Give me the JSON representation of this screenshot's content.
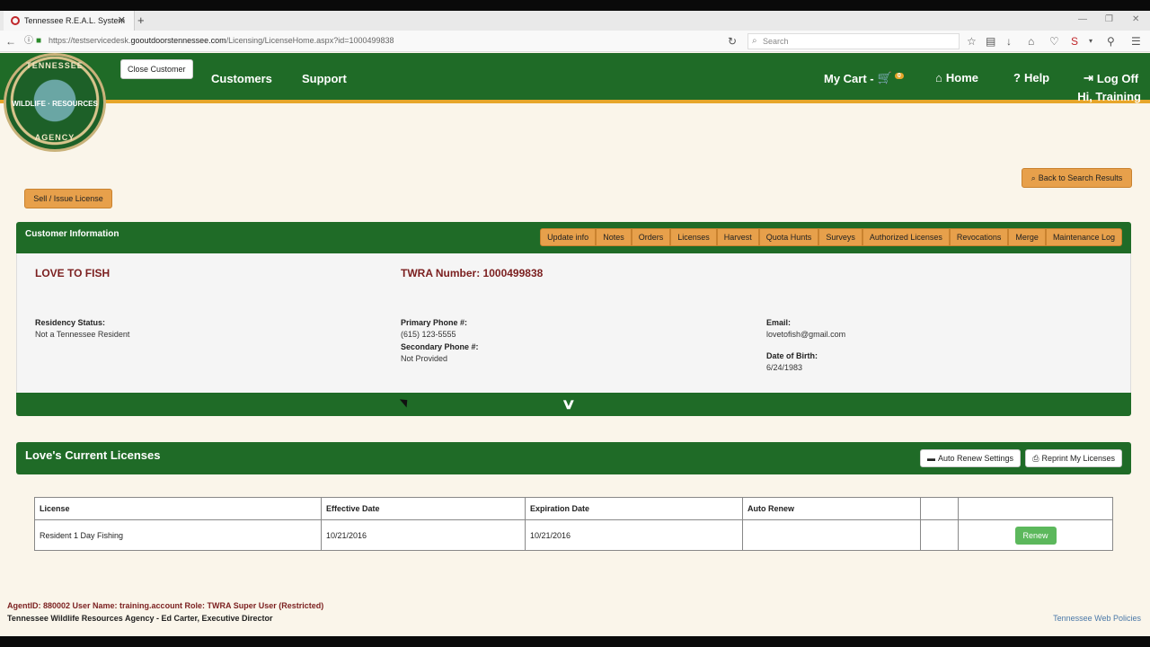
{
  "browser": {
    "tab_title": "Tennessee R.E.A.L. System",
    "url_prefix": "https://testservicedesk.",
    "url_domain": "gooutdoorstennessee.com",
    "url_path": "/Licensing/LicenseHome.aspx?id=1000499838",
    "search_placeholder": "Search"
  },
  "logo": {
    "ring_top": "TENNESSEE",
    "middle": "WILDLIFE · RESOURCES",
    "ring_bottom": "AGENCY"
  },
  "header": {
    "close_customer": "Close Customer",
    "nav": [
      "Customers",
      "Support"
    ],
    "cart_label": "My Cart -",
    "cart_count": "0",
    "home": "Home",
    "help": "Help",
    "logoff": "Log Off",
    "greeting": "Hi, Training"
  },
  "actions": {
    "sell_issue": "Sell / Issue License",
    "back_to_search": "Back to Search Results"
  },
  "customer_panel": {
    "title": "Customer Information",
    "tabs": [
      "Update info",
      "Notes",
      "Orders",
      "Licenses",
      "Harvest",
      "Quota Hunts",
      "Surveys",
      "Authorized Licenses",
      "Revocations",
      "Merge",
      "Maintenance Log"
    ],
    "name": "LOVE TO FISH",
    "twra_number": "TWRA Number: 1000499838",
    "residency_label": "Residency Status:",
    "residency_value": "Not a Tennessee Resident",
    "primary_phone_label": "Primary Phone #:",
    "primary_phone_value": "(615) 123-5555",
    "secondary_phone_label": "Secondary Phone #:",
    "secondary_phone_value": "Not Provided",
    "email_label": "Email:",
    "email_value": "lovetofish@gmail.com",
    "dob_label": "Date of Birth:",
    "dob_value": "6/24/1983"
  },
  "licenses_panel": {
    "title": "Love's Current Licenses",
    "auto_renew_settings": "Auto Renew Settings",
    "reprint": "Reprint My Licenses",
    "columns": [
      "License",
      "Effective Date",
      "Expiration Date",
      "Auto Renew",
      "",
      ""
    ],
    "rows": [
      {
        "license": "Resident 1 Day Fishing",
        "effective": "10/21/2016",
        "expiration": "10/21/2016",
        "auto_renew": "",
        "action": "Renew"
      }
    ]
  },
  "footer": {
    "agent_info": "AgentID: 880002 User Name: training.account Role: TWRA Super User (Restricted)",
    "agency": "Tennessee Wildlife Resources Agency - Ed Carter, Executive Director",
    "web_policies": "Tennessee Web Policies"
  },
  "colors": {
    "green": "#1f6b27",
    "orange": "#e7a04b",
    "gold": "#e6a62b",
    "maroon": "#7b1f1f",
    "renew_green": "#5cb85c"
  }
}
